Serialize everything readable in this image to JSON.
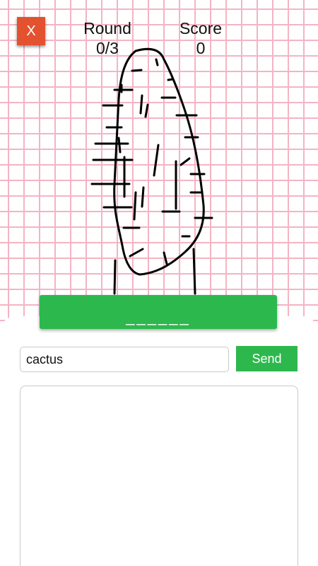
{
  "game": {
    "close_label": "X",
    "round_label": "Round",
    "round_value": "0/3",
    "score_label": "Score",
    "score_value": "0",
    "hidden_word": "______"
  },
  "guess": {
    "input_value": "cactus",
    "send_label": "Send"
  },
  "chat": {
    "messages": []
  },
  "colors": {
    "grid_line": "#f4b4c4",
    "close_button": "#e4512f",
    "accent_green": "#2db84d",
    "ink": "#000000"
  }
}
